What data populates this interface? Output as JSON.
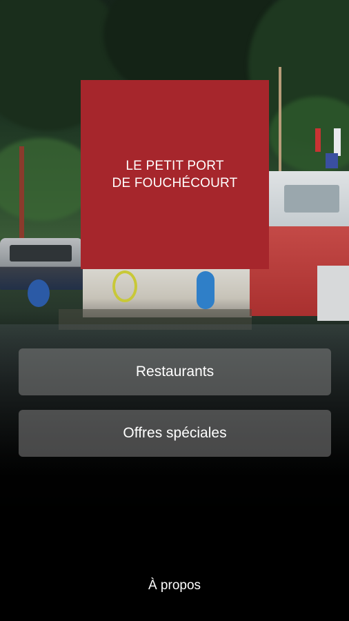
{
  "logo": {
    "line1": "LE PETIT PORT",
    "line2": "DE FOUCHÉCOURT",
    "color": "#a6262c"
  },
  "menu": {
    "restaurants_label": "Restaurants",
    "offres_label": "Offres spéciales"
  },
  "footer": {
    "about_label": "À propos"
  }
}
